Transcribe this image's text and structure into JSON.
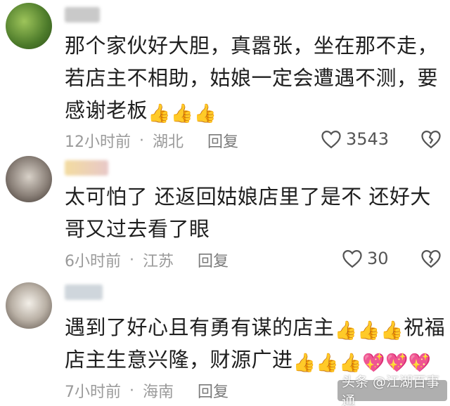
{
  "comments": [
    {
      "text": "那个家伙好大胆，真嚣张，坐在那不走，若店主不相助，姑娘一定会遭遇不测，要感谢老板",
      "emojis": [
        "👍",
        "👍",
        "👍"
      ],
      "time": "12小时前",
      "location": "湖北",
      "reply_label": "回复",
      "likes": "3543"
    },
    {
      "text": "太可怕了  还返回姑娘店里了是不  还好大哥又过去看了眼",
      "emojis": [],
      "time": "6小时前",
      "location": "江苏",
      "reply_label": "回复",
      "likes": "30"
    },
    {
      "text_line1": "遇到了好心且有勇有谋的店主",
      "emojis_line1": [
        "👍",
        "👍",
        "👍"
      ],
      "text_line1b": "祝福",
      "text_line2": "店主生意兴隆，财源广进",
      "emojis_line2": [
        "👍",
        "👍",
        "👍",
        "💖",
        "💖",
        "💖"
      ],
      "time": "7小时前",
      "location": "海南",
      "reply_label": "回复",
      "likes": ""
    }
  ],
  "separator": "·",
  "watermark": "头条 @江湖百事通",
  "colors": {
    "meta": "#9a9a9a",
    "text": "#1f1f1f"
  }
}
